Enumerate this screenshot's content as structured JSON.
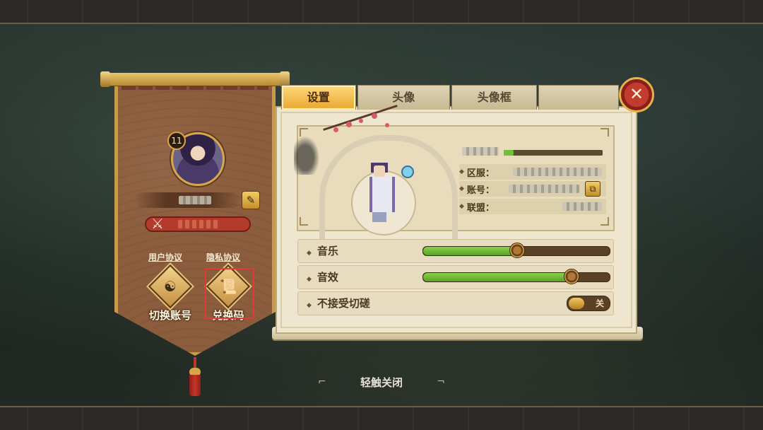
{
  "player": {
    "level": "11"
  },
  "links": {
    "user_agreement": "用户协议",
    "privacy_agreement": "隐私协议"
  },
  "buttons": {
    "switch_account": "切换账号",
    "redeem_code": "兑换码"
  },
  "tabs": [
    {
      "label": "设置",
      "active": true
    },
    {
      "label": "头像",
      "active": false
    },
    {
      "label": "头像框",
      "active": false
    }
  ],
  "info": {
    "server_label": "区服：",
    "account_label": "账号：",
    "alliance_label": "联盟：",
    "exp_progress": 0.1
  },
  "settings": {
    "music": {
      "label": "音乐",
      "value": 0.5
    },
    "sfx": {
      "label": "音效",
      "value": 0.79
    },
    "no_sparring": {
      "label": "不接受切磋",
      "state": "关"
    }
  },
  "footer": {
    "tap_to_close": "轻触关闭"
  },
  "colors": {
    "accent_gold": "#e8a630",
    "slider_green": "#6fbf3a",
    "close_red": "#c33a2e",
    "highlight_red": "#e23a36"
  },
  "icons": {
    "close": "close-icon",
    "edit": "pencil-icon",
    "guild": "crossed-swords-icon",
    "switch_account": "swirl-icon",
    "redeem": "scroll-icon",
    "copy": "copy-icon"
  }
}
